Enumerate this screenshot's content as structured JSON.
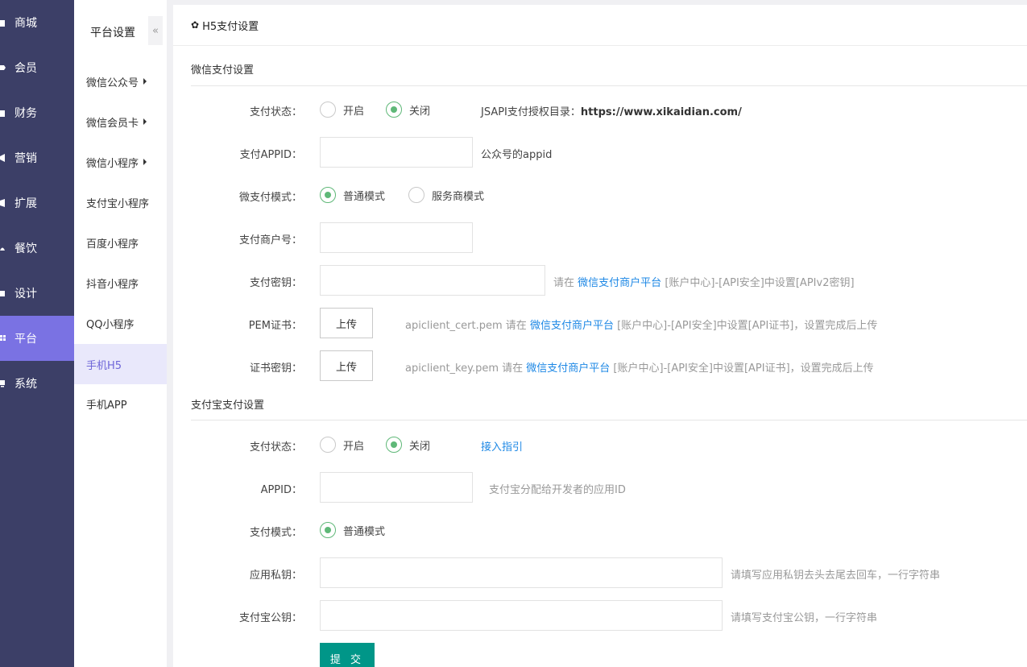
{
  "sidebar": {
    "items": [
      {
        "label": "商城",
        "icon": "store-icon"
      },
      {
        "label": "会员",
        "icon": "tag-icon"
      },
      {
        "label": "财务",
        "icon": "wallet-icon"
      },
      {
        "label": "营销",
        "icon": "megaphone-icon"
      },
      {
        "label": "扩展",
        "icon": "cube-icon"
      },
      {
        "label": "餐饮",
        "icon": "food-icon"
      },
      {
        "label": "设计",
        "icon": "brush-icon"
      },
      {
        "label": "平台",
        "icon": "grid-icon"
      },
      {
        "label": "系统",
        "icon": "monitor-icon"
      }
    ],
    "active_index": 7,
    "active_color": "#7a72e3",
    "bg_color": "#3c3f67"
  },
  "submenu": {
    "title": "平台设置",
    "collapse_icon": "«",
    "items": [
      {
        "label": "微信公众号",
        "has_arrow": true
      },
      {
        "label": "微信会员卡",
        "has_arrow": true
      },
      {
        "label": "微信小程序",
        "has_arrow": true
      },
      {
        "label": "支付宝小程序",
        "has_arrow": false
      },
      {
        "label": "百度小程序",
        "has_arrow": false
      },
      {
        "label": "抖音小程序",
        "has_arrow": false
      },
      {
        "label": "QQ小程序",
        "has_arrow": false
      },
      {
        "label": "手机H5",
        "has_arrow": false
      },
      {
        "label": "手机APP",
        "has_arrow": false
      }
    ],
    "active_index": 7
  },
  "panel": {
    "title": "H5支付设置",
    "title_icon": "gear-icon"
  },
  "wechat": {
    "section_title": "微信支付设置",
    "status": {
      "label": "支付状态：",
      "options": [
        "开启",
        "关闭"
      ],
      "selected": "关闭"
    },
    "jsapi_note_prefix": "JSAPI支付授权目录：",
    "jsapi_note_url": "https://www.xikaidian.com/",
    "appid": {
      "label": "支付APPID：",
      "value": "",
      "help": "公众号的appid"
    },
    "mode": {
      "label": "微支付模式：",
      "options": [
        "普通模式",
        "服务商模式"
      ],
      "selected": "普通模式"
    },
    "merchant_no": {
      "label": "支付商户号：",
      "value": ""
    },
    "secret": {
      "label": "支付密钥：",
      "value": "",
      "help_prefix": "请在",
      "help_link": "微信支付商户平台",
      "help_suffix": "[账户中心]-[API安全]中设置[APIv2密钥]"
    },
    "pem": {
      "label": "PEM证书：",
      "button": "上传",
      "help_prefix": "apiclient_cert.pem 请在",
      "help_link": "微信支付商户平台",
      "help_suffix": "[账户中心]-[API安全]中设置[API证书]，设置完成后上传"
    },
    "cert_key": {
      "label": "证书密钥：",
      "button": "上传",
      "help_prefix": "apiclient_key.pem 请在",
      "help_link": "微信支付商户平台",
      "help_suffix": "[账户中心]-[API安全]中设置[API证书]，设置完成后上传"
    }
  },
  "alipay": {
    "section_title": "支付宝支付设置",
    "status": {
      "label": "支付状态：",
      "options": [
        "开启",
        "关闭"
      ],
      "selected": "关闭"
    },
    "guide_link": "接入指引",
    "appid": {
      "label": "APPID：",
      "value": "",
      "help": "支付宝分配给开发者的应用ID"
    },
    "mode": {
      "label": "支付模式：",
      "options": [
        "普通模式"
      ],
      "selected": "普通模式"
    },
    "private_key": {
      "label": "应用私钥：",
      "value": "",
      "help": "请填写应用私钥去头去尾去回车，一行字符串"
    },
    "public_key": {
      "label": "支付宝公钥：",
      "value": "",
      "help": "请填写支付宝公钥，一行字符串"
    }
  },
  "submit_label": "提 交",
  "colors": {
    "radio_checked": "#5fb878",
    "submit": "#009688",
    "link": "#1e88e5"
  }
}
